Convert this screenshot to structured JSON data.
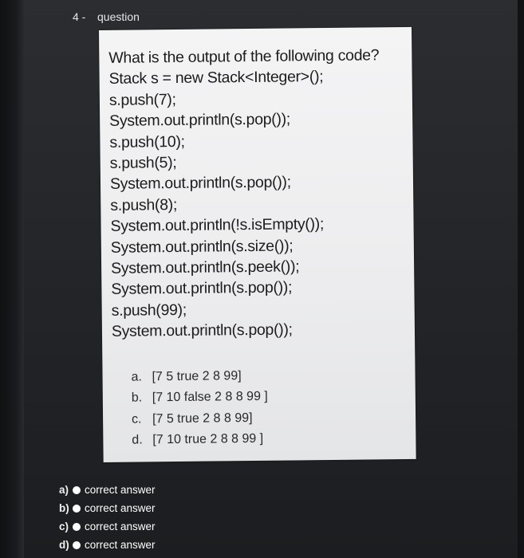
{
  "header": {
    "number": "4 -",
    "label": "question"
  },
  "question": {
    "lines": [
      "What is the output of the following code?",
      "Stack s = new Stack<Integer>();",
      "s.push(7);",
      "System.out.println(s.pop());",
      "s.push(10);",
      "s.push(5);",
      "System.out.println(s.pop());",
      "s.push(8);",
      "System.out.println(!s.isEmpty());",
      "System.out.println(s.size());",
      "System.out.println(s.peek());",
      "System.out.println(s.pop());",
      "s.push(99);",
      "System.out.println(s.pop());"
    ],
    "options": [
      {
        "letter": "a.",
        "text": "[7 5 true 2 8 99]"
      },
      {
        "letter": "b.",
        "text": "[7 10 false 2 8 8 99 ]"
      },
      {
        "letter": "c.",
        "text": "[7 5 true 2 8 8 99]"
      },
      {
        "letter": "d.",
        "text": "[7 10 true 2 8 8 99 ]"
      }
    ]
  },
  "answers": [
    {
      "letter": "a)",
      "text": "correct answer"
    },
    {
      "letter": "b)",
      "text": "correct answer"
    },
    {
      "letter": "c)",
      "text": "correct answer"
    },
    {
      "letter": "d)",
      "text": "correct answer"
    }
  ]
}
